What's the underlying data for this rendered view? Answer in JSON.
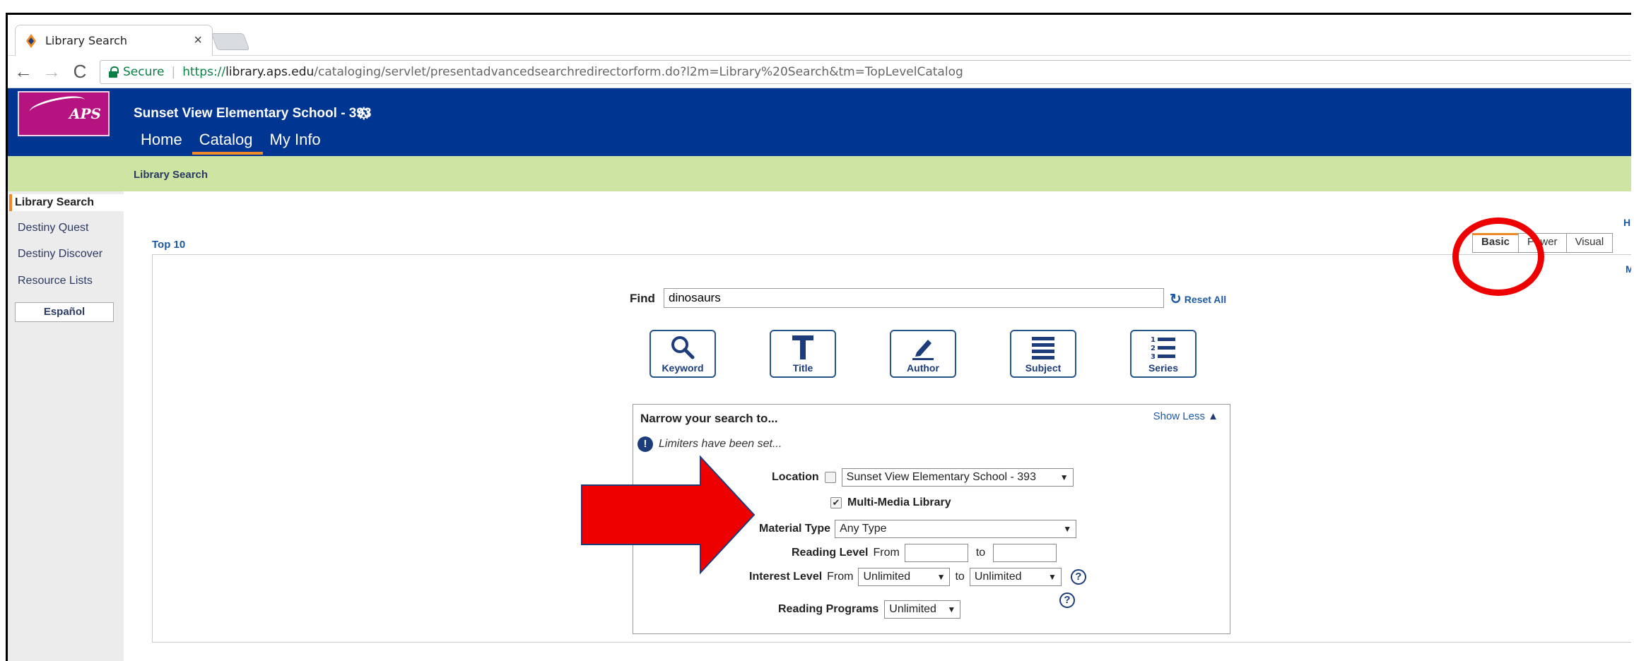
{
  "browser": {
    "tab_title": "Library Search",
    "tab_close": "×",
    "secure_label": "Secure",
    "url_scheme": "https://",
    "url_host": "library.aps.edu",
    "url_path": "/cataloging/servlet/presentadvancedsearchredirectorform.do?l2m=Library%20Search&tm=TopLevelCatalog"
  },
  "header": {
    "logo_text": "APS",
    "school_name": "Sunset View Elementary School - 393",
    "nav": [
      "Home",
      "Catalog",
      "My Info"
    ],
    "active_nav": "Catalog",
    "subbar_title": "Library Search"
  },
  "sidebar": {
    "items": [
      "Library Search",
      "Destiny Quest",
      "Destiny Discover",
      "Resource Lists"
    ],
    "active": "Library Search",
    "language_button": "Español"
  },
  "content": {
    "top10": "Top 10",
    "mode_tabs": [
      "Basic",
      "Power",
      "Visual"
    ],
    "active_mode": "Basic",
    "cut_h": "H",
    "cut_m": "M",
    "find_label": "Find",
    "find_value": "dinosaurs",
    "reset_label": "Reset All",
    "search_buttons": [
      {
        "label": "Keyword",
        "icon": "magnifier-icon"
      },
      {
        "label": "Title",
        "icon": "title-t-icon"
      },
      {
        "label": "Author",
        "icon": "pencil-icon"
      },
      {
        "label": "Subject",
        "icon": "lines-icon"
      },
      {
        "label": "Series",
        "icon": "numbered-list-icon"
      }
    ]
  },
  "narrow": {
    "title": "Narrow your search to...",
    "show_less": "Show Less",
    "limiters_note": "Limiters have been set...",
    "location_label": "Location",
    "location_value": "Sunset View Elementary School - 393",
    "location_checked": false,
    "multimedia_label": "Multi-Media Library",
    "multimedia_checked": true,
    "material_label": "Material Type",
    "material_value": "Any Type",
    "reading_level_label": "Reading Level",
    "from_label": "From",
    "to_label": "to",
    "interest_level_label": "Interest Level",
    "interest_from": "Unlimited",
    "interest_to": "Unlimited",
    "reading_programs_label": "Reading Programs",
    "reading_programs_value": "Unlimited"
  },
  "colors": {
    "header_blue": "#003591",
    "subbar_green": "#cde4a2",
    "accent_orange": "#f08a24",
    "annotation_red": "#ee0000"
  }
}
